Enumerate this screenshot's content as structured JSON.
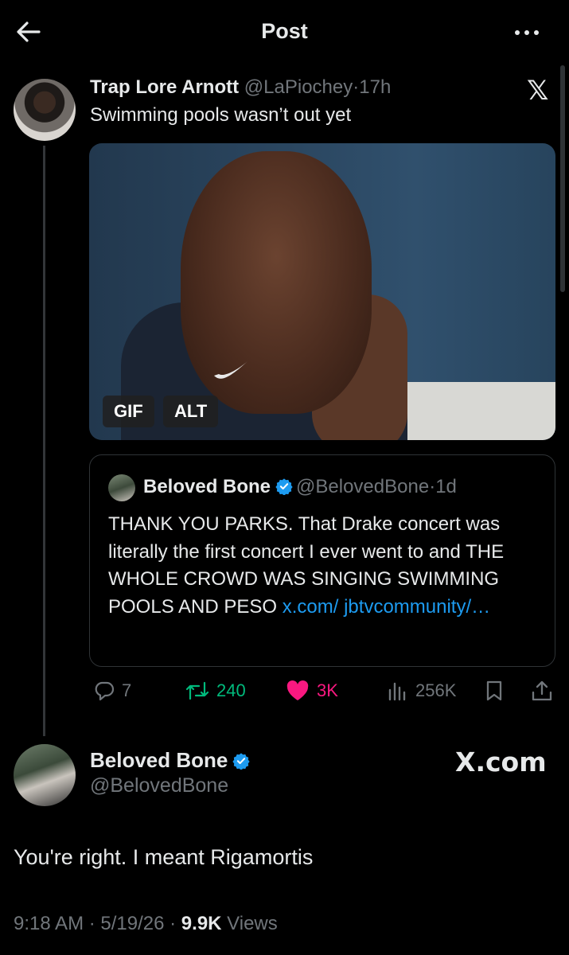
{
  "header": {
    "title": "Post",
    "back_icon": "arrow-left-icon",
    "more_icon": "more-dots-icon"
  },
  "tweet": {
    "name": "Trap Lore Arnott",
    "handle": "@LaPiochey",
    "separator": "·",
    "time": "17h",
    "text": "Swimming pools wasn’t out yet",
    "media": {
      "gif_label": "GIF",
      "alt_label": "ALT"
    },
    "quote": {
      "name": "Beloved Bone",
      "handle": "@BelovedBone",
      "separator": "·",
      "time": "1d",
      "text": "THANK YOU PARKS. That Drake concert was literally the first concert I ever went to and THE WHOLE CROWD WAS SINGING SWIMMING POOLS AND PESO ",
      "link": "x.com/ jbtvcommunity/…"
    },
    "actions": {
      "replies": "7",
      "reposts": "240",
      "likes": "3K",
      "views": "256K"
    }
  },
  "reply_post": {
    "name": "Beloved Bone",
    "handle": "@BelovedBone",
    "watermark": "X.com",
    "text": "You're right. I meant Rigamortis",
    "time": "9:18 AM",
    "date": "5/19/26",
    "views_count": "9.9K",
    "views_label": "Views"
  },
  "colors": {
    "background": "#000000",
    "accent": "#1d9bf0",
    "repost": "#00ba7c",
    "like": "#f91880",
    "muted": "#71767b"
  }
}
